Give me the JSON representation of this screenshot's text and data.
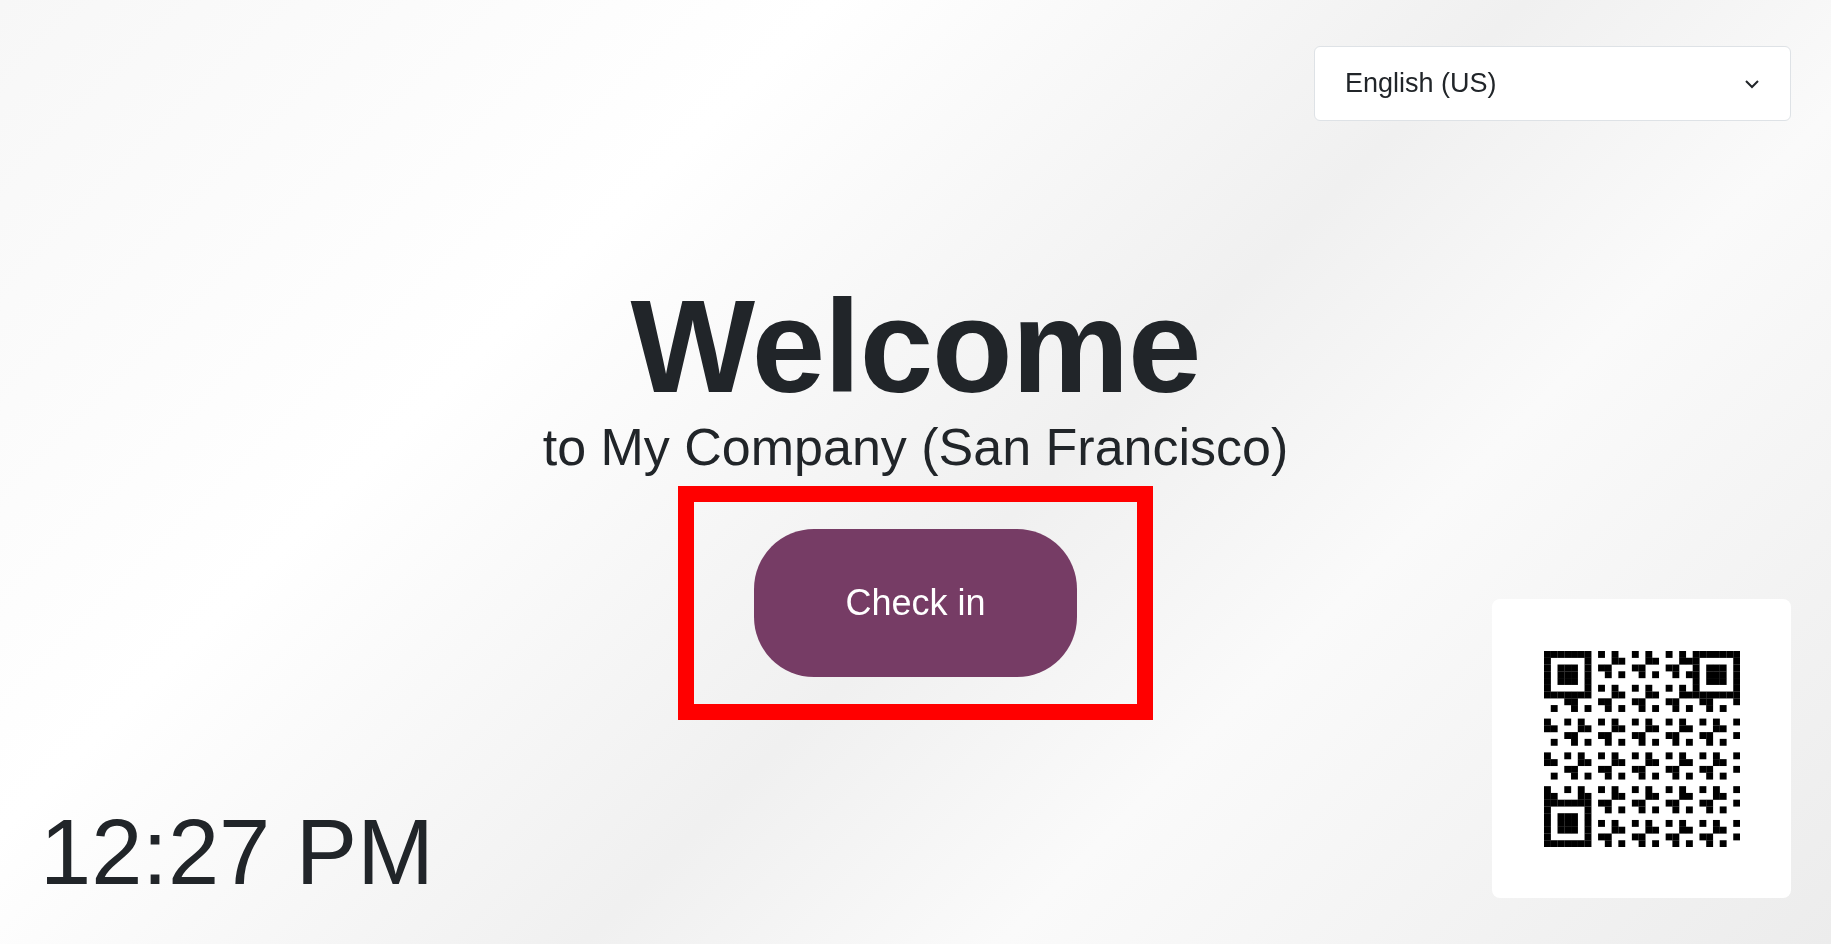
{
  "language_select": {
    "value": "English (US)"
  },
  "welcome": {
    "title": "Welcome",
    "subtitle": "to My Company (San Francisco)"
  },
  "check_in_button": {
    "label": "Check in",
    "highlighted": true
  },
  "clock": "12:27 PM"
}
